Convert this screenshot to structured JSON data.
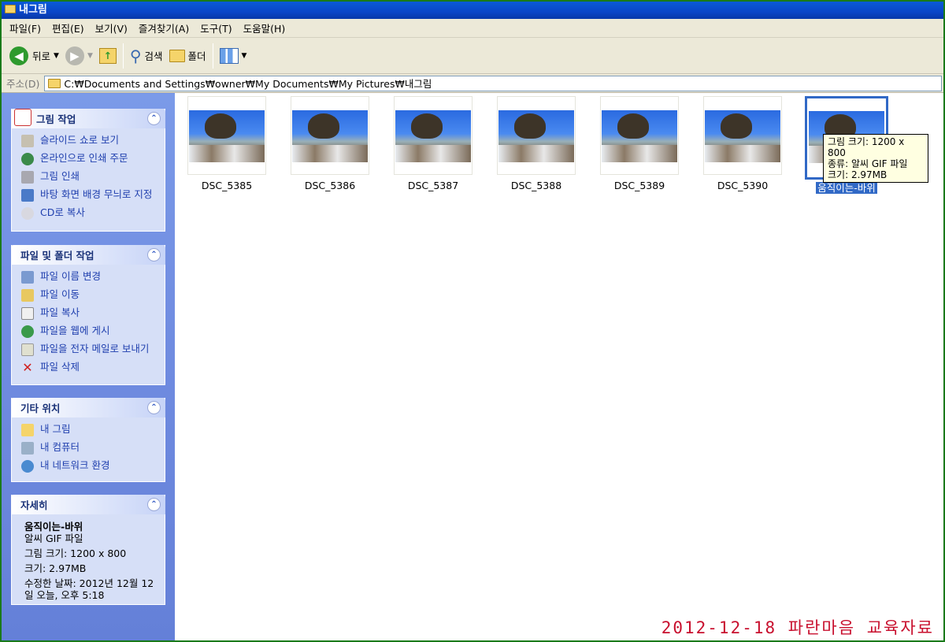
{
  "window": {
    "title": "내그림"
  },
  "menu": [
    "파일(F)",
    "편집(E)",
    "보기(V)",
    "즐겨찾기(A)",
    "도구(T)",
    "도움말(H)"
  ],
  "toolbar": {
    "back": "뒤로",
    "search": "검색",
    "folders": "폴더"
  },
  "address": {
    "label": "주소(D)",
    "path": "C:₩Documents and Settings₩owner₩My Documents₩My Pictures₩내그림"
  },
  "panels": {
    "picture_tasks": {
      "title": "그림 작업",
      "items": [
        "슬라이드 쇼로 보기",
        "온라인으로 인쇄 주문",
        "그림 인쇄",
        "바탕 화면 배경 무늬로 지정",
        "CD로 복사"
      ]
    },
    "file_tasks": {
      "title": "파일 및 폴더 작업",
      "items": [
        "파일 이름 변경",
        "파일 이동",
        "파일 복사",
        "파일을 웹에 게시",
        "파일을 전자 메일로 보내기",
        "파일 삭제"
      ]
    },
    "other_places": {
      "title": "기타 위치",
      "items": [
        "내 그림",
        "내 컴퓨터",
        "내 네트워크 환경"
      ]
    },
    "details": {
      "title": "자세히",
      "name": "움직이는-바위",
      "type": "알씨 GIF 파일",
      "dims": "그림 크기: 1200 x 800",
      "size": "크기: 2.97MB",
      "modified": "수정한 날짜: 2012년 12월 12일 오늘, 오후 5:18"
    }
  },
  "files": [
    "DSC_5385",
    "DSC_5386",
    "DSC_5387",
    "DSC_5388",
    "DSC_5389",
    "DSC_5390",
    "움직이는-바위"
  ],
  "tooltip": {
    "line1": "그림 크기: 1200 x 800",
    "line2": "종류: 알씨 GIF 파일",
    "line3": "크기: 2.97MB"
  },
  "watermark": "2012-12-18 파란마음 교육자료",
  "colors": {
    "selection": "#3169c6",
    "watermark": "#c8102e"
  }
}
